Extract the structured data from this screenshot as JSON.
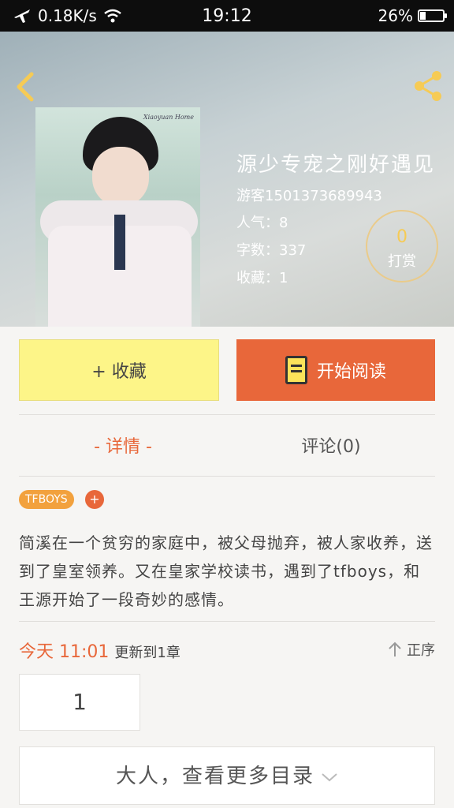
{
  "status_bar": {
    "net_speed": "0.18K/s",
    "time": "19:12",
    "battery": "26%"
  },
  "book": {
    "title": "源少专宠之刚好遇见",
    "author": "游客1501373689943",
    "popularity": "人气：8",
    "word_count": "字数：337",
    "favorites": "收藏：1",
    "cover_signature": "Xiaoyuan Home"
  },
  "tip": {
    "count": "0",
    "label": "打赏"
  },
  "actions": {
    "favorite_label": "+ 收藏",
    "read_label": "开始阅读"
  },
  "tabs": {
    "detail": "- 详情 -",
    "comments": "评论(0)"
  },
  "tags": {
    "items": [
      "TFBOYS"
    ],
    "add": "+"
  },
  "description": "简溪在一个贫穷的家庭中，被父母抛弃，被人家收养，送到了皇室领养。又在皇家学校读书，遇到了tfboys，和王源开始了一段奇妙的感情。",
  "update": {
    "date": "今天 11:01",
    "text": "更新到1章"
  },
  "order_label": "正序",
  "chapter_number": "1",
  "more_catalog": "大人，查看更多目录",
  "colors": {
    "accent": "#e8673a",
    "favorite_bg": "#fdf588",
    "tag": "#f2a13d",
    "icon_yellow": "#f6cb55"
  }
}
